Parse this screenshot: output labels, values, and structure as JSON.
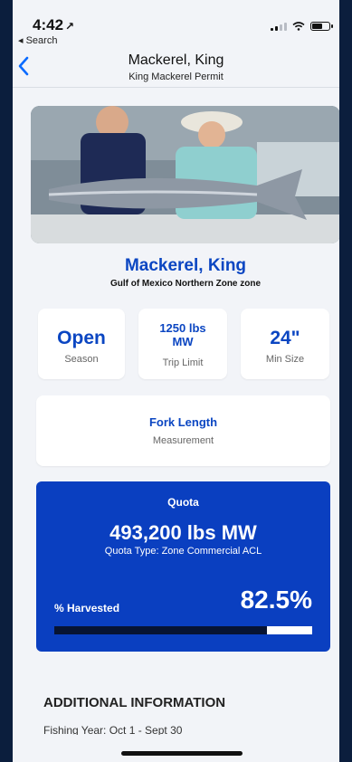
{
  "status_bar": {
    "time": "4:42",
    "location_glyph": "↗",
    "back_app": "◂ Search"
  },
  "nav": {
    "title": "Mackerel, King",
    "subtitle": "King Mackerel Permit"
  },
  "species": {
    "name": "Mackerel, King",
    "zone": "Gulf of Mexico Northern Zone zone"
  },
  "stats": {
    "season_value": "Open",
    "season_label": "Season",
    "trip_limit_line1": "1250 lbs",
    "trip_limit_line2": "MW",
    "trip_limit_label": "Trip Limit",
    "min_size_value": "24\"",
    "min_size_label": "Min Size",
    "measurement_value": "Fork Length",
    "measurement_label": "Measurement"
  },
  "quota": {
    "title": "Quota",
    "amount": "493,200 lbs MW",
    "type": "Quota Type: Zone Commercial ACL",
    "harvested_label": "% Harvested",
    "harvested_pct": "82.5%",
    "harvested_fraction": 0.825
  },
  "additional": {
    "heading": "ADDITIONAL INFORMATION",
    "fishing_year": "Fishing Year: Oct 1 - Sept 30"
  },
  "colors": {
    "accent": "#0b46c2",
    "quota_bg": "#0a3fc0",
    "progress_fill": "#071433"
  }
}
